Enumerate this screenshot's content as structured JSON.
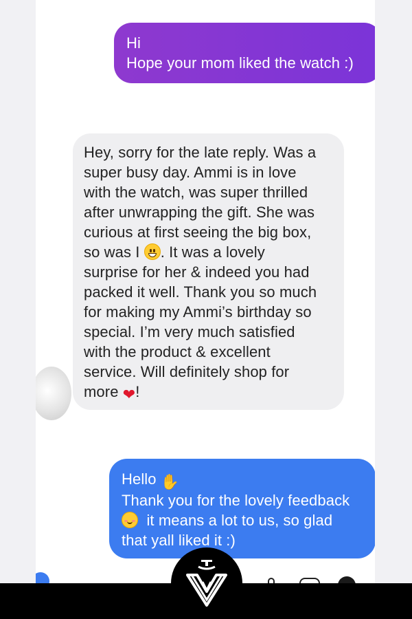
{
  "conversation": {
    "outgoing_1": {
      "lines": [
        "Hi",
        "Hope your mom liked the watch :)"
      ]
    },
    "incoming_1": {
      "lines": [
        "Hey, sorry for the late reply. Was a",
        "super busy day. Ammi is in love",
        "with the watch, was super thrilled",
        "after unwrapping the gift. She was",
        "curious at first seeing the big box,",
        "so was I",
        ". It was a lovely",
        "surprise for her & indeed you had",
        "packed it well. Thank you so much",
        "for making my Ammi’s birthday so",
        "special. I’m very much satisfied",
        "with the product & excellent",
        "service. Will definitely shop for",
        "more",
        "!"
      ]
    },
    "outgoing_2": {
      "lines": [
        "Hello",
        "Thank you for the lovely feedback",
        "it means a lot to us, so glad",
        "that yall liked it :)"
      ]
    }
  },
  "emojis": {
    "grin": "grinning-face",
    "heart": "❤",
    "wave": "✋",
    "blush": "smiling-face"
  },
  "colors": {
    "outgoing_purple": "#8e39cf",
    "outgoing_blue": "#3c7cf0",
    "incoming_gray": "#efeff1",
    "bottom_bar": "#000000"
  }
}
